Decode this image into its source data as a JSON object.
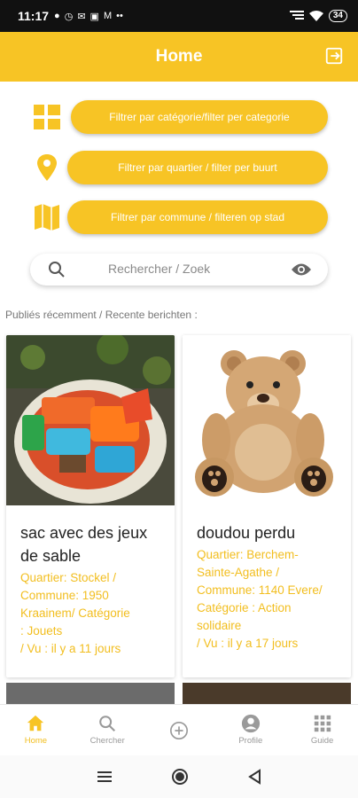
{
  "status_bar": {
    "time": "11:17",
    "notification_icons": [
      "●",
      "◷",
      "✉",
      "▣",
      "M",
      "••"
    ],
    "battery": "34"
  },
  "header": {
    "title": "Home"
  },
  "filters": [
    {
      "label": "Filtrer par catégorie/filter per categorie",
      "icon": "grid-icon"
    },
    {
      "label": "Filtrer par quartier / filter per buurt",
      "icon": "location-pin-icon"
    },
    {
      "label": "Filtrer par commune / filteren op stad",
      "icon": "map-icon"
    }
  ],
  "search": {
    "placeholder": "Rechercher / Zoek"
  },
  "recent_label": "Publiés récemment / Recente berichten :",
  "posts": [
    {
      "title": "sac avec des jeux de sable",
      "meta_lines": [
        "Quartier: Stockel /",
        "Commune: 1950",
        "Kraainem/ Catégorie",
        ": Jouets",
        "/ Vu : il y a 11 jours"
      ]
    },
    {
      "title": "doudou perdu",
      "meta_lines": [
        "Quartier: Berchem-",
        "Sainte-Agathe /",
        "Commune: 1140 Evere/",
        "Catégorie : Action",
        "solidaire",
        "/ Vu : il y a 17 jours"
      ]
    }
  ],
  "bottom_nav": [
    {
      "label": "Home",
      "icon": "home-icon",
      "active": true
    },
    {
      "label": "Chercher",
      "icon": "search-icon",
      "active": false
    },
    {
      "label": "",
      "icon": "add-circle-icon",
      "active": false
    },
    {
      "label": "Profile",
      "icon": "profile-icon",
      "active": false
    },
    {
      "label": "Guide",
      "icon": "apps-grid-icon",
      "active": false
    }
  ],
  "colors": {
    "accent": "#F7C425",
    "accent_text": "#F2BE1F",
    "status_bar": "#111111"
  }
}
